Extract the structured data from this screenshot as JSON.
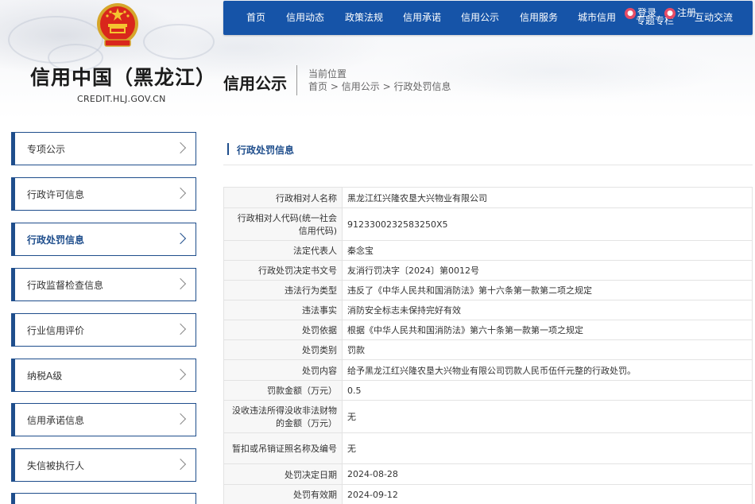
{
  "site": {
    "title": "信用中国（黑龙江）",
    "domain": "CREDIT.HLJ.GOV.CN",
    "emblem_icon": "national-emblem"
  },
  "nav": {
    "items": [
      "首页",
      "信用动态",
      "政策法规",
      "信用承诺",
      "信用公示",
      "信用服务",
      "城市信用",
      "专题专栏",
      "互动交流"
    ],
    "login": "登录",
    "register": "注册"
  },
  "page": {
    "section_title": "信用公示",
    "location_label": "当前位置",
    "breadcrumb": [
      "首页",
      "信用公示",
      "行政处罚信息"
    ],
    "breadcrumb_sep": ">"
  },
  "sidebar": {
    "items": [
      {
        "label": "专项公示",
        "active": false
      },
      {
        "label": "行政许可信息",
        "active": false
      },
      {
        "label": "行政处罚信息",
        "active": true
      },
      {
        "label": "行政监督检查信息",
        "active": false
      },
      {
        "label": "行业信用评价",
        "active": false
      },
      {
        "label": "纳税A级",
        "active": false
      },
      {
        "label": "信用承诺信息",
        "active": false
      },
      {
        "label": "失信被执行人",
        "active": false
      },
      {
        "label": "",
        "active": false
      }
    ]
  },
  "content": {
    "title": "行政处罚信息",
    "rows": [
      {
        "key": "行政相对人名称",
        "value": "黑龙江红兴隆农垦大兴物业有限公司"
      },
      {
        "key": "行政相对人代码(统一社会信用代码)",
        "value": "9123300232583250X5"
      },
      {
        "key": "法定代表人",
        "value": "秦念宝"
      },
      {
        "key": "行政处罚决定书文号",
        "value": "友消行罚决字〔2024〕第0012号"
      },
      {
        "key": "违法行为类型",
        "value": "违反了《中华人民共和国消防法》第十六条第一款第二项之规定"
      },
      {
        "key": "违法事实",
        "value": "消防安全标志未保持完好有效"
      },
      {
        "key": "处罚依据",
        "value": "根据《中华人民共和国消防法》第六十条第一款第一项之规定"
      },
      {
        "key": "处罚类别",
        "value": "罚款"
      },
      {
        "key": "处罚内容",
        "value": "给予黑龙江红兴隆农垦大兴物业有限公司罚款人民币伍仟元整的行政处罚。"
      },
      {
        "key": "罚款金额（万元）",
        "value": "0.5"
      },
      {
        "key": "没收违法所得没收非法财物的金额（万元）",
        "value": "无"
      },
      {
        "key": "暂扣或吊销证照名称及编号",
        "value": "无"
      },
      {
        "key": "处罚决定日期",
        "value": "2024-08-28"
      },
      {
        "key": "处罚有效期",
        "value": "2024-09-12"
      }
    ]
  },
  "colors": {
    "nav_bg": "#1654a8",
    "accent": "#1f4e8c"
  }
}
